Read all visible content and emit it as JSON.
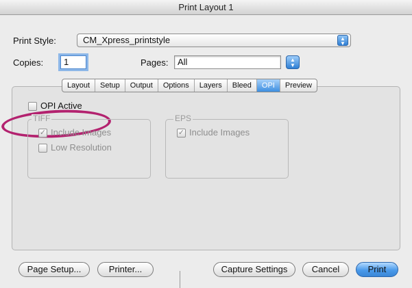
{
  "window": {
    "title": "Print Layout 1"
  },
  "print_style": {
    "label": "Print Style:",
    "value": "CM_Xpress_printstyle"
  },
  "copies": {
    "label": "Copies:",
    "value": "1"
  },
  "pages": {
    "label": "Pages:",
    "value": "All"
  },
  "tabs": [
    {
      "label": "Layout"
    },
    {
      "label": "Setup"
    },
    {
      "label": "Output"
    },
    {
      "label": "Options"
    },
    {
      "label": "Layers"
    },
    {
      "label": "Bleed"
    },
    {
      "label": "OPI",
      "active": true
    },
    {
      "label": "Preview"
    }
  ],
  "opi": {
    "active_label": "OPI Active",
    "active_checked": false,
    "tiff": {
      "title": "TIFF",
      "include_images": {
        "label": "Include Images",
        "checked": true
      },
      "low_resolution": {
        "label": "Low Resolution",
        "checked": false
      }
    },
    "eps": {
      "title": "EPS",
      "include_images": {
        "label": "Include Images",
        "checked": true
      }
    }
  },
  "buttons": {
    "page_setup": "Page Setup...",
    "printer": "Printer...",
    "capture_settings": "Capture Settings",
    "cancel": "Cancel",
    "print": "Print"
  },
  "highlight_color": "#b3226f"
}
